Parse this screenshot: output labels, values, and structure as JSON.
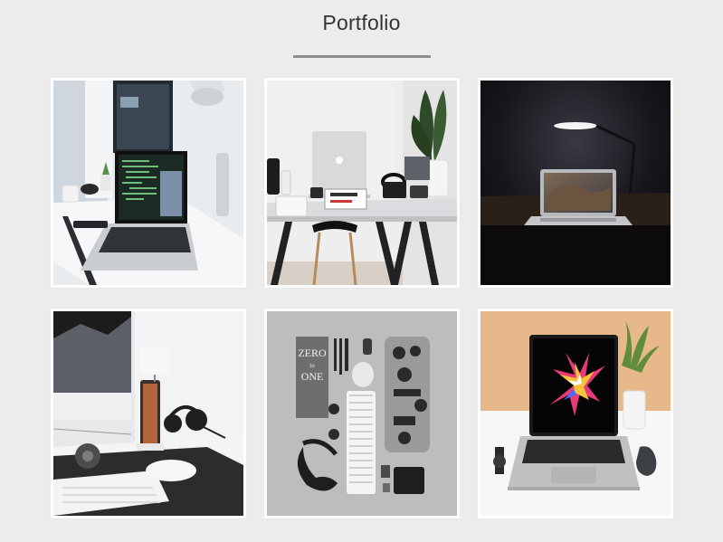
{
  "page": {
    "title": "Portfolio"
  },
  "portfolio": {
    "items": [
      {
        "name": "desk-laptop-code"
      },
      {
        "name": "desk-macbook-trestle"
      },
      {
        "name": "dark-laptop-lamp"
      },
      {
        "name": "imac-phone-headphones"
      },
      {
        "name": "flatlay-gadgets",
        "book_title_line1": "ZERO",
        "book_title_line2": "to",
        "book_title_line3": "ONE"
      },
      {
        "name": "macbook-orange-wall"
      }
    ]
  }
}
